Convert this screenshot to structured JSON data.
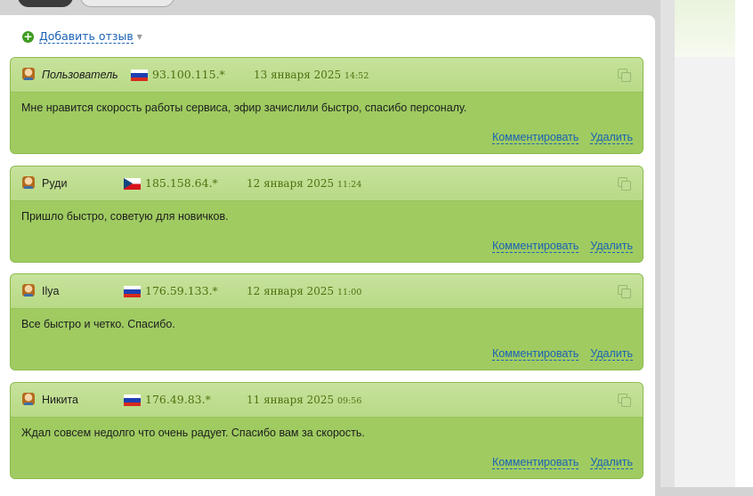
{
  "add_review": {
    "label": "Добавить отзыв"
  },
  "reviews": [
    {
      "author": "Пользователь",
      "ip": "93.100.115.*",
      "date": "13 января 2025",
      "time": "14:52",
      "text": "Мне нравится скорость работы сервиса, эфир зачислили быстро, спасибо персоналу.",
      "flag": "ru"
    },
    {
      "author": "Руди",
      "ip": "185.158.64.*",
      "date": "12 января 2025",
      "time": "11:24",
      "text": "Пришло быстро, советую для новичков.",
      "flag": "cz"
    },
    {
      "author": "Ilya",
      "ip": "176.59.133.*",
      "date": "12 января 2025",
      "time": "11:00",
      "text": "Все быстро и четко. Спасибо.",
      "flag": "ru"
    },
    {
      "author": "Никита",
      "ip": "176.49.83.*",
      "date": "11 января 2025",
      "time": "09:56",
      "text": "Ждал совсем недолго что очень радует. Спасибо вам за скорость.",
      "flag": "ru"
    }
  ],
  "actions": {
    "comment_label": "Комментировать",
    "delete_label": "Удалить"
  },
  "colors": {
    "accent_link": "#1b62b5",
    "card_green": "#a6d06a",
    "header_green": "#c7e29c",
    "ip_text": "#51700f"
  }
}
